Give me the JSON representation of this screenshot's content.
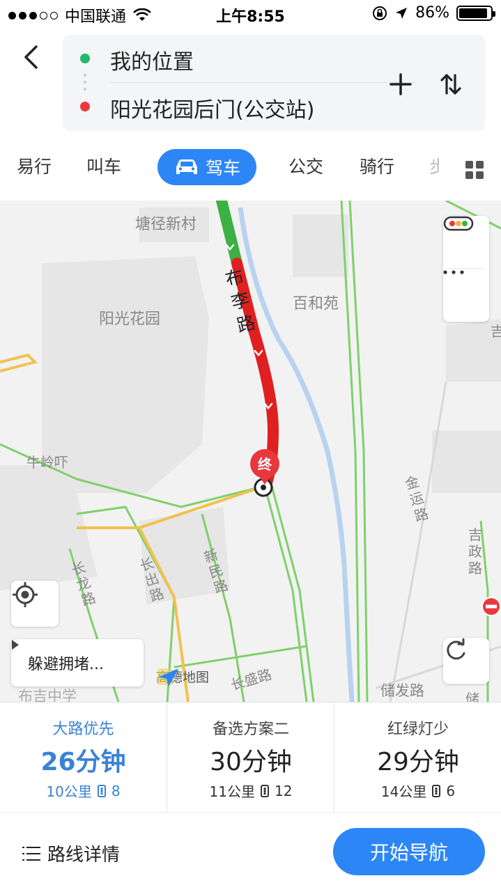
{
  "status_bar": {
    "carrier": "中国联通",
    "time": "上午8:55",
    "battery": "86%"
  },
  "route": {
    "origin": "我的位置",
    "destination": "阳光花园后门(公交站)"
  },
  "tabs": [
    {
      "label": "易行"
    },
    {
      "label": "叫车"
    },
    {
      "label": "驾车",
      "active": true
    },
    {
      "label": "公交"
    },
    {
      "label": "骑行"
    },
    {
      "label": "步"
    }
  ],
  "map": {
    "labels": {
      "tangjing": "塘径新村",
      "yangguang": "阳光花园",
      "baihe": "百和苑",
      "buli": "布李路",
      "niuling": "牛岭吓",
      "jinyun": "金运路",
      "jizheng": "吉政路",
      "changlong": "长龙路",
      "changchu": "长出路",
      "xinmin": "新民路",
      "changsheng": "长盛路",
      "chufa": "储发路",
      "buji": "布吉中学",
      "ji": "吉",
      "chu": "储"
    },
    "end_marker": "终",
    "avoid_label": "躲避拥堵...",
    "logo_text": "高德地图"
  },
  "route_options": [
    {
      "label": "大路优先",
      "time": "26分钟",
      "distance": "10公里",
      "lights": "8",
      "selected": true
    },
    {
      "label": "备选方案二",
      "time": "30分钟",
      "distance": "11公里",
      "lights": "12",
      "selected": false
    },
    {
      "label": "红绿灯少",
      "time": "29分钟",
      "distance": "14公里",
      "lights": "6",
      "selected": false
    }
  ],
  "bottom": {
    "detail_label": "路线详情",
    "start_label": "开始导航"
  },
  "colors": {
    "accent": "#2d86f5",
    "origin_dot": "#20b86a",
    "destination_dot": "#e8383d",
    "traffic_green": "#3cb043",
    "traffic_red": "#e02020"
  }
}
